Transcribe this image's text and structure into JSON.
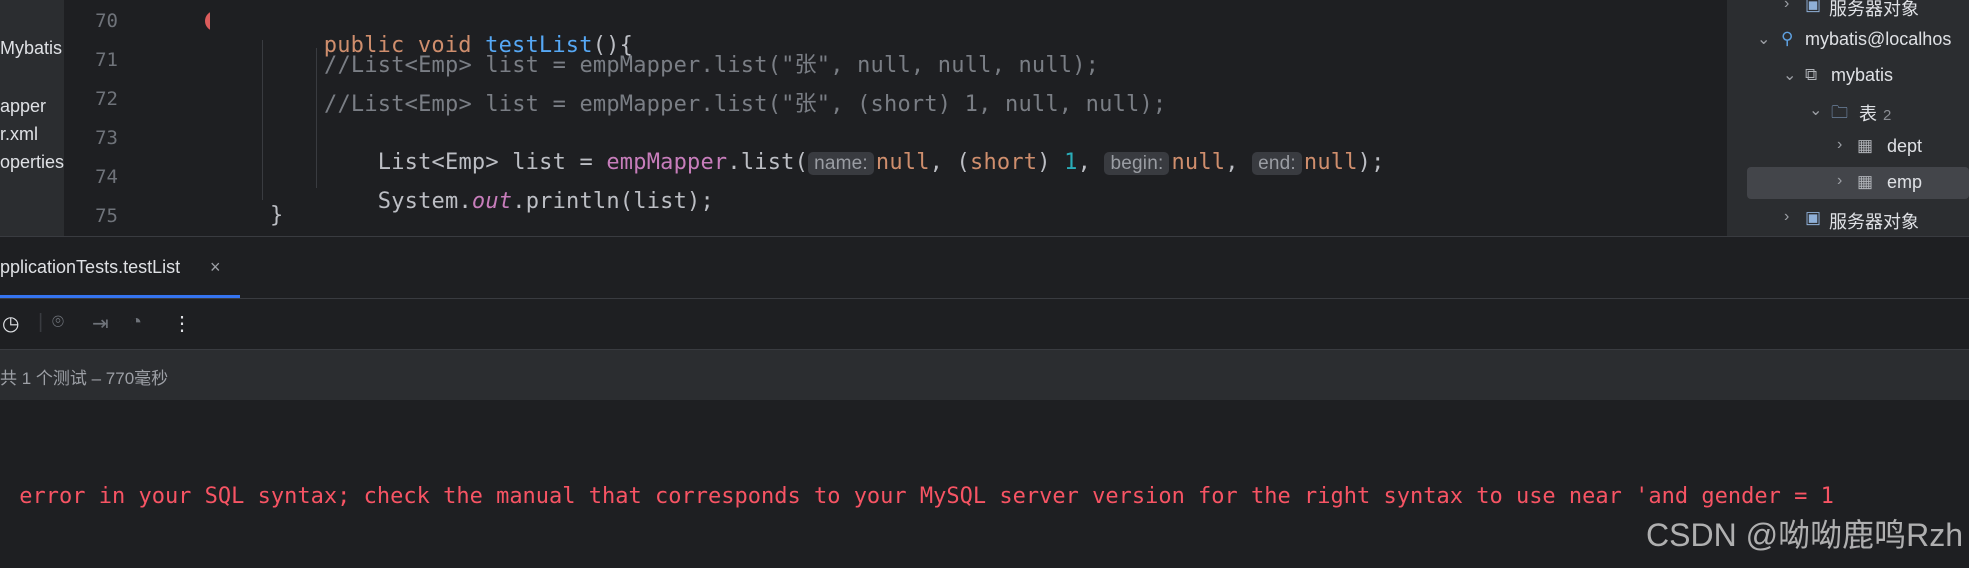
{
  "project": {
    "items": [
      "Mybatis",
      "apper",
      "r.xml",
      "operties"
    ]
  },
  "editor": {
    "line_numbers": [
      "70",
      "71",
      "72",
      "73",
      "74",
      "75"
    ],
    "lines": {
      "l70": {
        "kw1": "public",
        "kw2": "void",
        "fn": "testList",
        "rest": "(){"
      },
      "l71": {
        "comment": "//List<Emp> list = empMapper.list(\"张\", null, null, null);"
      },
      "l72": {
        "comment": "//List<Emp> list = empMapper.list(\"张\", (short) 1, null, null);"
      },
      "l73": {
        "decl": "List<Emp> list = ",
        "obj": "empMapper",
        "dot": ".",
        "method": "list",
        "open": "(",
        "hint1": "name:",
        "null1": "null",
        "sep1": ", (",
        "short": "short",
        "sep2": ") ",
        "num": "1",
        "sep3": ", ",
        "hint2": "begin:",
        "null2": "null",
        "sep4": ", ",
        "hint3": "end:",
        "null3": "null",
        "close": ");"
      },
      "l74": {
        "sys": "System.",
        "out": "out",
        "rest": ".println(list);"
      },
      "l75": {
        "brace": "}"
      }
    }
  },
  "db_panel": {
    "rows": [
      {
        "label": "服务器对象"
      },
      {
        "label": "mybatis@localhos"
      },
      {
        "label": "mybatis"
      },
      {
        "label": "表",
        "badge": "2"
      },
      {
        "label": "dept"
      },
      {
        "label": "emp"
      },
      {
        "label": "服务器对象"
      }
    ]
  },
  "run": {
    "tab_label": "pplicationTests.testList",
    "tab_close": "×",
    "status": "共 1 个测试 – 770毫秒",
    "error_text": " error in your SQL syntax; check the manual that corresponds to your MySQL server version for the right syntax to use near 'and gender = 1",
    "watermark": "CSDN @呦呦鹿鸣Rzh"
  },
  "icons": {
    "run_gutter": "run-error-icon",
    "toolbar": [
      "history-icon",
      "camera-icon",
      "import-icon",
      "performance-icon",
      "more-icon"
    ]
  }
}
